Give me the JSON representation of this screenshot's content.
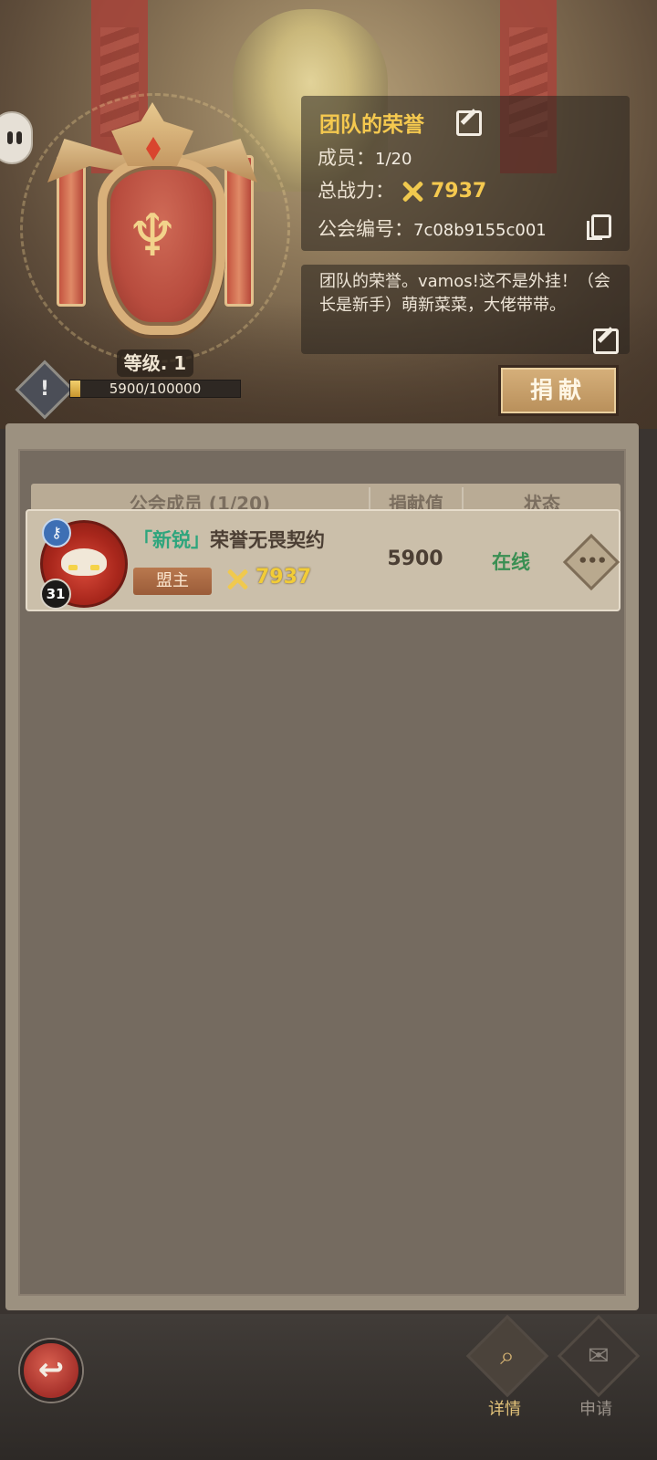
{
  "header": {
    "guild_name": "团队的荣誉",
    "members_label": "成员：",
    "members_value": "1/20",
    "power_label": "总战力：",
    "power_value": "7937",
    "guild_id_label": "公会编号：",
    "guild_id_value": "7c08b9155c001",
    "description": "团队的荣誉。vamos!这不是外挂！（会长是新手）萌新菜菜，大佬带带。",
    "level_label": "等级. 1",
    "exp_text": "5900/100000",
    "exp_progress": 0.059,
    "donate_label": "捐献"
  },
  "table": {
    "columns": [
      "公会成员 (1/20)",
      "捐献值",
      "状态"
    ]
  },
  "members": [
    {
      "tag": "「新锐」",
      "name": "荣誉无畏契约",
      "level": "31",
      "role": "盟主",
      "power": "7937",
      "contribution": "5900",
      "status": "在线",
      "more": "•••"
    }
  ],
  "bottom_nav": {
    "back": "↩",
    "tabs": [
      {
        "label": "详情",
        "icon": "magnifier-icon",
        "active": true
      },
      {
        "label": "申请",
        "icon": "scroll-icon",
        "active": false
      }
    ]
  },
  "colors": {
    "gold": "#f5c94f",
    "online": "#3a8f53",
    "tag_green": "#2ea57d"
  }
}
